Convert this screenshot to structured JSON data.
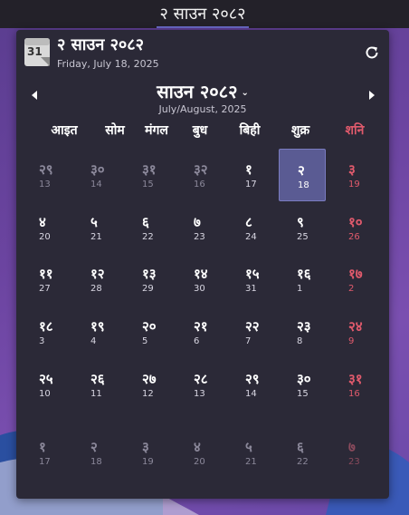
{
  "topbar": {
    "title": "२ साउन २०८२"
  },
  "popup": {
    "header": {
      "icon": "calendar-icon",
      "icon_text": "31",
      "title": "२ साउन २०८२",
      "subtitle": "Friday, July 18, 2025"
    },
    "refresh_icon": "refresh-icon",
    "nav": {
      "prev_icon": "triangle-left-icon",
      "next_icon": "triangle-right-icon"
    },
    "month": {
      "title": "साउन २०८२",
      "caret": "⌄",
      "subtitle": "July/August, 2025"
    },
    "weekdays": [
      "आइत",
      "सोम",
      "मंगल",
      "बुध",
      "बिही",
      "शुक्र",
      "शनि"
    ],
    "weeks": [
      [
        [
          "२९",
          "13",
          "dim"
        ],
        [
          "३०",
          "14",
          "dim"
        ],
        [
          "३१",
          "15",
          "dim"
        ],
        [
          "३२",
          "16",
          "dim"
        ],
        [
          "१",
          "17",
          "norm"
        ],
        [
          "२",
          "18",
          "today"
        ],
        [
          "३",
          "19",
          "red"
        ]
      ],
      [
        [
          "४",
          "20",
          "norm"
        ],
        [
          "५",
          "21",
          "norm"
        ],
        [
          "६",
          "22",
          "norm"
        ],
        [
          "७",
          "23",
          "norm"
        ],
        [
          "८",
          "24",
          "norm"
        ],
        [
          "९",
          "25",
          "norm"
        ],
        [
          "१०",
          "26",
          "red"
        ]
      ],
      [
        [
          "११",
          "27",
          "norm"
        ],
        [
          "१२",
          "28",
          "norm"
        ],
        [
          "१३",
          "29",
          "norm"
        ],
        [
          "१४",
          "30",
          "norm"
        ],
        [
          "१५",
          "31",
          "norm"
        ],
        [
          "१६",
          "1",
          "norm"
        ],
        [
          "१७",
          "2",
          "red"
        ]
      ],
      [
        [
          "१८",
          "3",
          "norm"
        ],
        [
          "१९",
          "4",
          "norm"
        ],
        [
          "२०",
          "5",
          "norm"
        ],
        [
          "२१",
          "6",
          "norm"
        ],
        [
          "२२",
          "7",
          "norm"
        ],
        [
          "२३",
          "8",
          "norm"
        ],
        [
          "२४",
          "9",
          "red"
        ]
      ],
      [
        [
          "२५",
          "10",
          "norm"
        ],
        [
          "२६",
          "11",
          "norm"
        ],
        [
          "२७",
          "12",
          "norm"
        ],
        [
          "२८",
          "13",
          "norm"
        ],
        [
          "२९",
          "14",
          "norm"
        ],
        [
          "३०",
          "15",
          "norm"
        ],
        [
          "३१",
          "16",
          "red"
        ]
      ],
      [
        [
          "१",
          "17",
          "dim"
        ],
        [
          "२",
          "18",
          "dim"
        ],
        [
          "३",
          "19",
          "dim"
        ],
        [
          "४",
          "20",
          "dim"
        ],
        [
          "५",
          "21",
          "dim"
        ],
        [
          "६",
          "22",
          "dim"
        ],
        [
          "७",
          "23",
          "reddim"
        ]
      ]
    ]
  },
  "colors": {
    "accent": "#6a6ac8",
    "weekend": "#e05a6c",
    "today_bg": "#5a5b93",
    "panel": "#2b2937"
  }
}
